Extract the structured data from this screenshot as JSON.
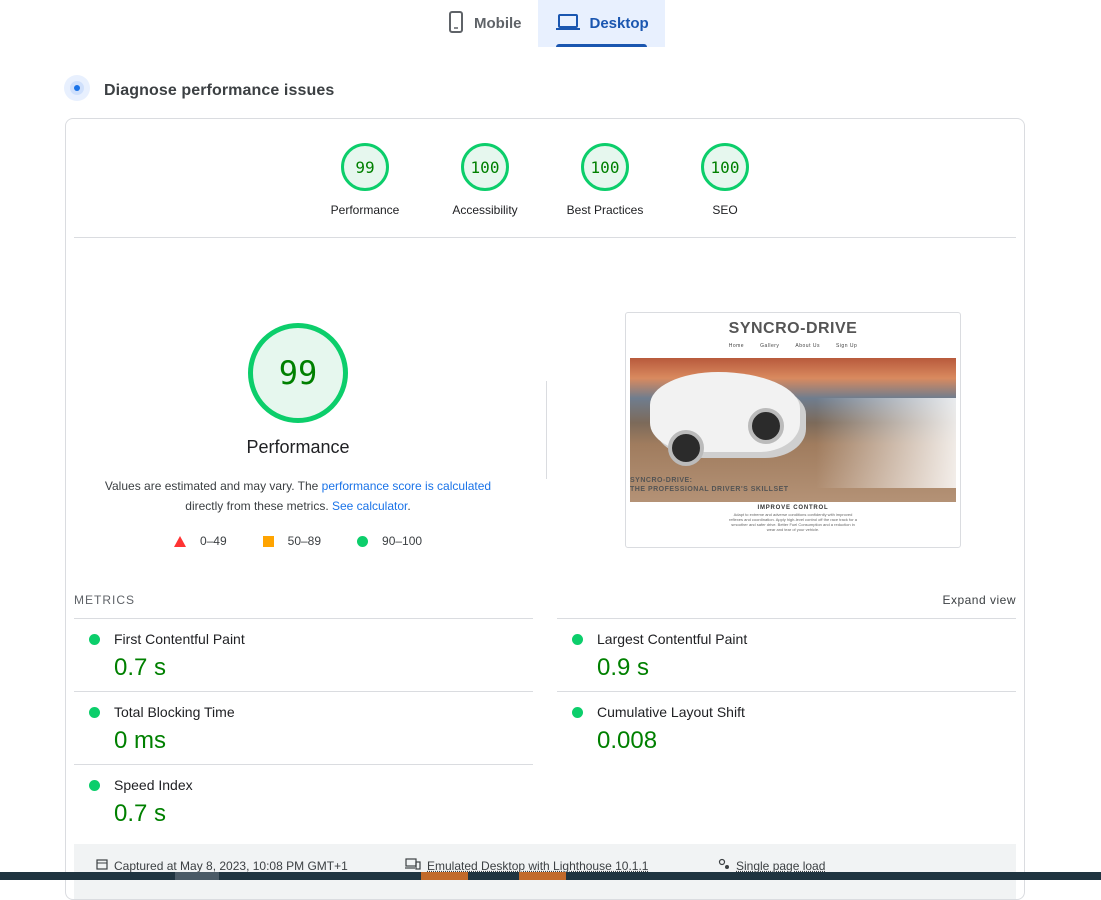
{
  "tabs": [
    {
      "label": "Mobile",
      "icon": "phone-icon"
    },
    {
      "label": "Desktop",
      "icon": "laptop-icon",
      "active": true
    }
  ],
  "diagnose": {
    "title": "Diagnose performance issues"
  },
  "scores": [
    {
      "value": "99",
      "label": "Performance"
    },
    {
      "value": "100",
      "label": "Accessibility"
    },
    {
      "value": "100",
      "label": "Best Practices"
    },
    {
      "value": "100",
      "label": "SEO"
    }
  ],
  "performance": {
    "score": "99",
    "title": "Performance",
    "desc_prefix": "Values are estimated and may vary. The ",
    "link1": "performance score is calculated",
    "desc_mid": "directly from these metrics. ",
    "link2": "See calculator",
    "desc_end": "."
  },
  "legend": [
    {
      "range": "0–49",
      "color": "#ff3333"
    },
    {
      "range": "50–89",
      "color": "#ffa400"
    },
    {
      "range": "90–100",
      "color": "#0cce6b"
    }
  ],
  "screenshot": {
    "brand": "SYNCRO-DRIVE",
    "nav": [
      "Home",
      "Gallery",
      "About Us",
      "Sign Up"
    ],
    "hero_line1": "SYNCRO-DRIVE:",
    "hero_line2": "THE PROFESSIONAL DRIVER'S SKILLSET",
    "section_title": "IMPROVE CONTROL",
    "section_text": "Adapt to extreme and adverse conditions confidently with improved reflexes and coordination. Apply high-level control off the race track for a smoother and safer drive. Better Fuel Consumption and a reduction in wear and tear of your vehicle."
  },
  "metrics": {
    "heading": "METRICS",
    "expand": "Expand view",
    "left": [
      {
        "name": "First Contentful Paint",
        "value": "0.7 s"
      },
      {
        "name": "Total Blocking Time",
        "value": "0 ms"
      },
      {
        "name": "Speed Index",
        "value": "0.7 s"
      }
    ],
    "right": [
      {
        "name": "Largest Contentful Paint",
        "value": "0.9 s"
      },
      {
        "name": "Cumulative Layout Shift",
        "value": "0.008"
      }
    ]
  },
  "footer": {
    "captured": "Captured at May 8, 2023, 10:08 PM GMT+1",
    "emulated": "Emulated Desktop with Lighthouse 10.1.1",
    "single": "Single page load"
  }
}
